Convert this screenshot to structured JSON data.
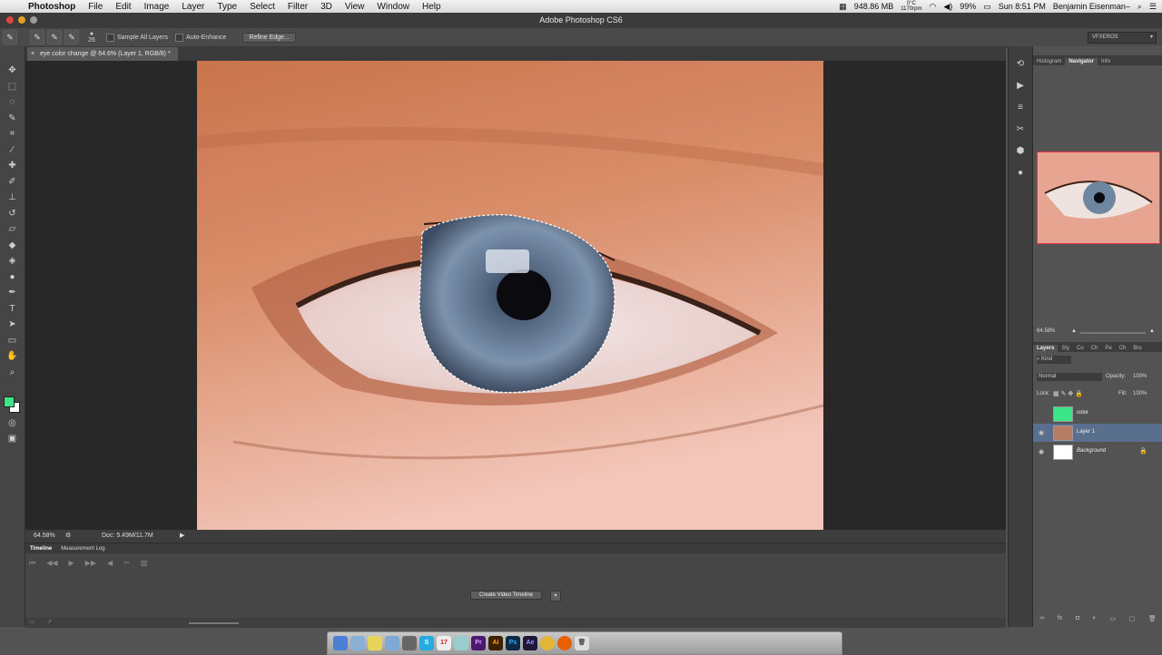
{
  "menubar": {
    "app_name": "Photoshop",
    "items": [
      "File",
      "Edit",
      "Image",
      "Layer",
      "Type",
      "Select",
      "Filter",
      "3D",
      "View",
      "Window",
      "Help"
    ],
    "status": {
      "memory": "948.86 MB",
      "temp": "0°C",
      "rpm": "1170rpm",
      "battery": "99%",
      "time": "Sun 8:51 PM",
      "user": "Benjamin Eisenman–"
    }
  },
  "window": {
    "title": "Adobe Photoshop CS6"
  },
  "options_bar": {
    "brush_size": "26",
    "sample_all_layers": "Sample All Layers",
    "auto_enhance": "Auto-Enhance",
    "refine_edge": "Refine Edge...",
    "workspace": "VFXEROS"
  },
  "document": {
    "tab_title": "eye color change @ 64.6% (Layer 1, RGB/8) *",
    "zoom": "64.58%",
    "doc_info": "Doc: 5.49M/11.7M"
  },
  "timeline": {
    "tabs": [
      "Timeline",
      "Measurement Log"
    ],
    "create_button": "Create Video Timeline"
  },
  "navigator": {
    "tabs": [
      "Histogram",
      "Navigator",
      "Info"
    ],
    "zoom": "64.58%"
  },
  "layers_panel": {
    "tabs": [
      "Layers",
      "Sty",
      "Co",
      "Ch",
      "Pa",
      "Ch",
      "Bru"
    ],
    "filter": "Kind",
    "blend_mode": "Normal",
    "opacity_label": "Opacity:",
    "opacity": "100%",
    "lock_label": "Lock:",
    "fill_label": "Fill:",
    "fill": "100%",
    "layers": [
      {
        "name": "color",
        "visible": false,
        "selected": false
      },
      {
        "name": "Layer 1",
        "visible": true,
        "selected": true
      },
      {
        "name": "Background",
        "visible": true,
        "selected": false,
        "locked": true
      }
    ]
  },
  "colors": {
    "foreground": "#3ce58a",
    "background": "#ffffff",
    "selected_layer": "#5a6f8e"
  },
  "dock": {
    "apps": [
      "Finder",
      "Preview",
      "Notes",
      "Mail",
      "Dictionary",
      "Skype",
      "Calendar",
      "Photos",
      "Pr",
      "Ai",
      "Ps",
      "Ae",
      "Chrome",
      "Firefox",
      "Trash"
    ]
  }
}
